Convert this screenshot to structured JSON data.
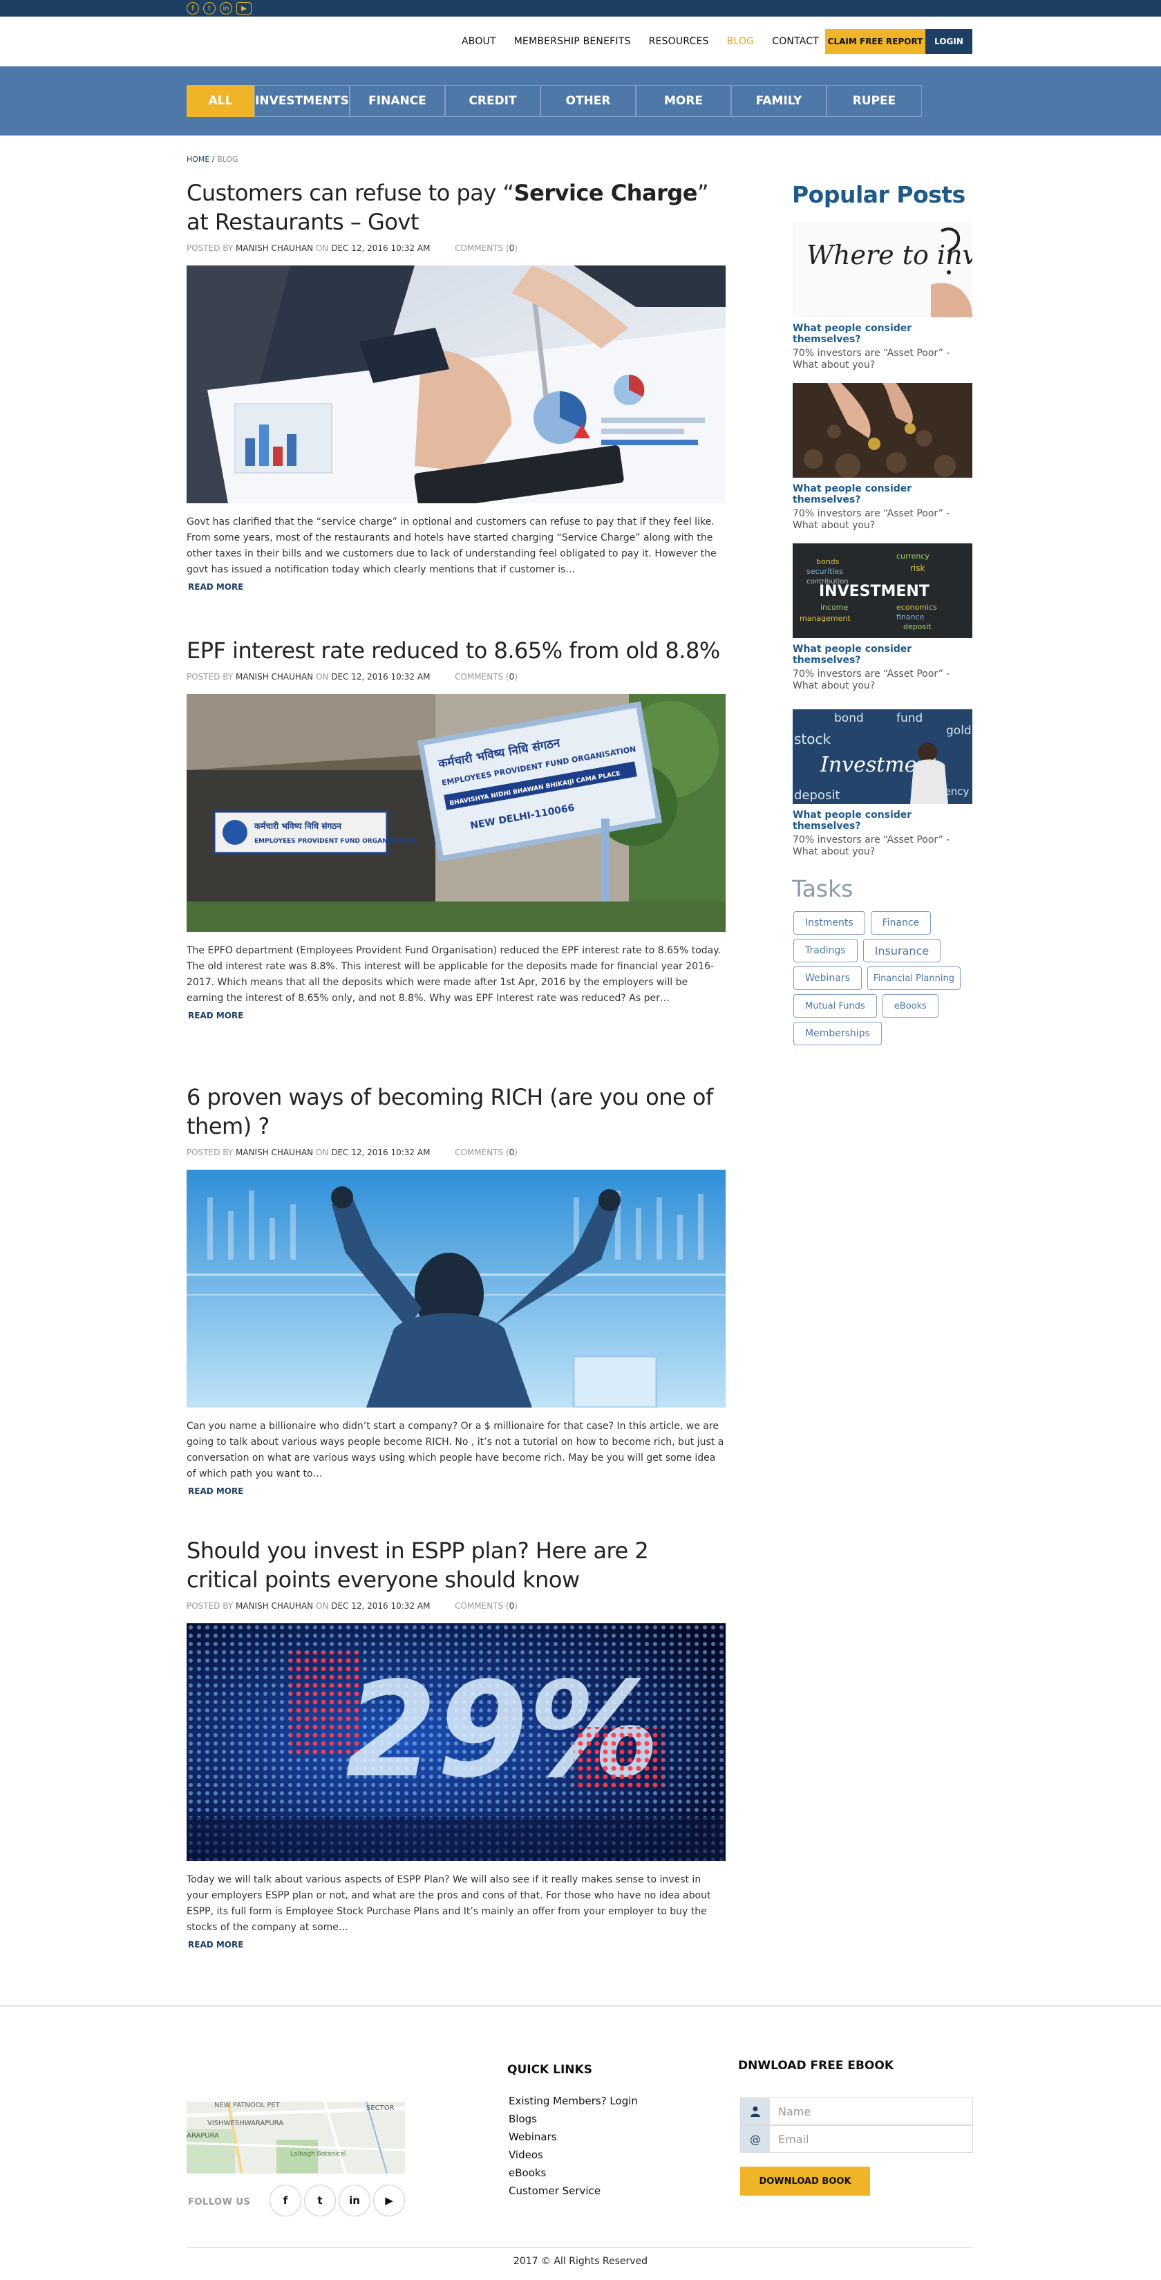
{
  "topbar": {
    "social": [
      "f",
      "t",
      "in",
      "▶"
    ]
  },
  "nav": {
    "links": [
      "ABOUT",
      "MEMBERSHIP BENEFITS",
      "RESOURCES",
      "BLOG",
      "CONTACT"
    ],
    "active": "BLOG",
    "claim": "CLAIM FREE REPORT",
    "login": "LOGIN"
  },
  "categories": [
    "ALL",
    "INVESTMENTS",
    "FINANCE",
    "CREDIT",
    "OTHER",
    "MORE",
    "FAMILY",
    "RUPEE"
  ],
  "breadcrumb": {
    "home": "HOME",
    "sep": " / ",
    "current": "BLOG"
  },
  "posts": [
    {
      "title_pre": "Customers can refuse to pay “",
      "title_bold": "Service Charge",
      "title_post": "” at Restaurants – Govt",
      "posted_by": "POSTED BY",
      "author": "MANISH CHAUHAN",
      "on": "ON",
      "date": "DEC 12, 2016 10:32 AM",
      "comments_label": "COMMENTS (",
      "comments": "0",
      "comments_close": ")",
      "excerpt": "Govt has clarified that the “service charge” in optional and customers can refuse to pay that if they feel like. From some years, most of the restaurants and hotels have started charging “Service Charge” along with the other taxes in their bills and we customers due to lack of understanding feel obligated to pay it. However the govt has issued a notification today which clearly mentions that if customer is…",
      "read_more": "READ MORE"
    },
    {
      "title": "EPF interest rate reduced to 8.65% from old 8.8%",
      "posted_by": "POSTED BY",
      "author": "MANISH CHAUHAN",
      "on": "ON",
      "date": "DEC 12, 2016 10:32 AM",
      "comments_label": "COMMENTS (",
      "comments": "0",
      "comments_close": ")",
      "excerpt": "The EPFO department (Employees Provident Fund Organisation) reduced the EPF interest rate to 8.65% today. The old interest rate was 8.8%. This interest will be applicable for the deposits made for financial year 2016-2017. Which means that all the deposits which were made after 1st Apr, 2016 by the employers will be earning the interest of 8.65% only, and not 8.8%. Why was EPF Interest rate was reduced? As per…",
      "read_more": "READ MORE",
      "sign_lines": [
        "कर्मचारी भविष्य निधि संगठन",
        "EMPLOYEES PROVIDENT FUND ORGANISATION",
        "BHAVISHYA NIDHI BHAWAN BHIKAIJI CAMA PLACE",
        "NEW DELHI-110066"
      ]
    },
    {
      "title": "6 proven ways of becoming RICH (are you one of them) ?",
      "posted_by": "POSTED BY",
      "author": "MANISH CHAUHAN",
      "on": "ON",
      "date": "DEC 12, 2016 10:32 AM",
      "comments_label": "COMMENTS (",
      "comments": "0",
      "comments_close": ")",
      "excerpt": "Can you name a billionaire who didn’t start a company? Or a $ millionaire for that case? In this article, we are going to talk about various ways people become RICH. No , it’s not a tutorial on how to become rich, but just a conversation on what are various ways using which people have become rich. May be you will get some idea of which path you want to…",
      "read_more": "READ MORE"
    },
    {
      "title": "Should you invest in ESPP plan? Here are 2 critical points everyone should know",
      "posted_by": "POSTED BY",
      "author": "MANISH CHAUHAN",
      "on": "ON",
      "date": "DEC 12, 2016 10:32 AM",
      "comments_label": "COMMENTS (",
      "comments": "0",
      "comments_close": ")",
      "excerpt": "Today we will talk about various aspects of ESPP Plan? We will also see if it really makes sense to invest in your employers ESPP plan or not, and what are the pros and cons of that. For those who have no idea about ESPP, its full form is Employee Stock Purchase Plans and It’s mainly an offer from your employer to buy the stocks of the company at some…",
      "read_more": "READ MORE",
      "image_text": "29%"
    }
  ],
  "sidebar": {
    "popular_title": "Popular Posts",
    "popular": [
      {
        "title": "What people consider themselves?",
        "desc": "70% investors are “Asset Poor” - What about you?",
        "image_text": "Where to invest"
      },
      {
        "title": "What people consider themselves?",
        "desc": "70% investors are “Asset Poor” - What about you?"
      },
      {
        "title": "What people consider themselves?",
        "desc": "70% investors are “Asset Poor” - What about you?",
        "image_text": "INVESTMENT",
        "image_words": [
          "bonds",
          "securities",
          "currency",
          "risk",
          "economics",
          "income",
          "finance",
          "deposit",
          "management",
          "contribution"
        ]
      },
      {
        "title": "What people consider themselves?",
        "desc": "70% investors are “Asset Poor” - What about you?",
        "image_text": "Investment",
        "image_words": [
          "bond",
          "fund",
          "gold",
          "stock",
          "deposit",
          "currency"
        ]
      }
    ],
    "tasks_title": "Tasks",
    "tags": [
      "Instments",
      "Finance",
      "Tradings",
      "Insurance",
      "Webinars",
      "Financial Planning",
      "Mutual Funds",
      "eBooks",
      "Memberships"
    ]
  },
  "footer": {
    "follow": "FOLLOW US",
    "social": [
      "f",
      "t",
      "in",
      "▶"
    ],
    "map_labels": [
      "NEW PATNOOL PET",
      "VISHWESHWARAPURA",
      "ARAPURA",
      "SECTOR",
      "Lalbagh Botanical"
    ],
    "quick_links_title": "QUICK LINKS",
    "quick_links": [
      "Existing Members? Login",
      "Blogs",
      "Webinars",
      "Videos",
      "eBooks",
      "Customer Service"
    ],
    "ebook_title": "DNWLOAD FREE EBOOK",
    "name_placeholder": "Name",
    "email_placeholder": "Email",
    "download": "DOWNLOAD BOOK",
    "copyright": "2017 ©  All Rights Reserved"
  },
  "colors": {
    "navy": "#1d3f63",
    "accent": "#f0b429",
    "band": "#4e78a7",
    "link_blue": "#1d5a8a"
  }
}
